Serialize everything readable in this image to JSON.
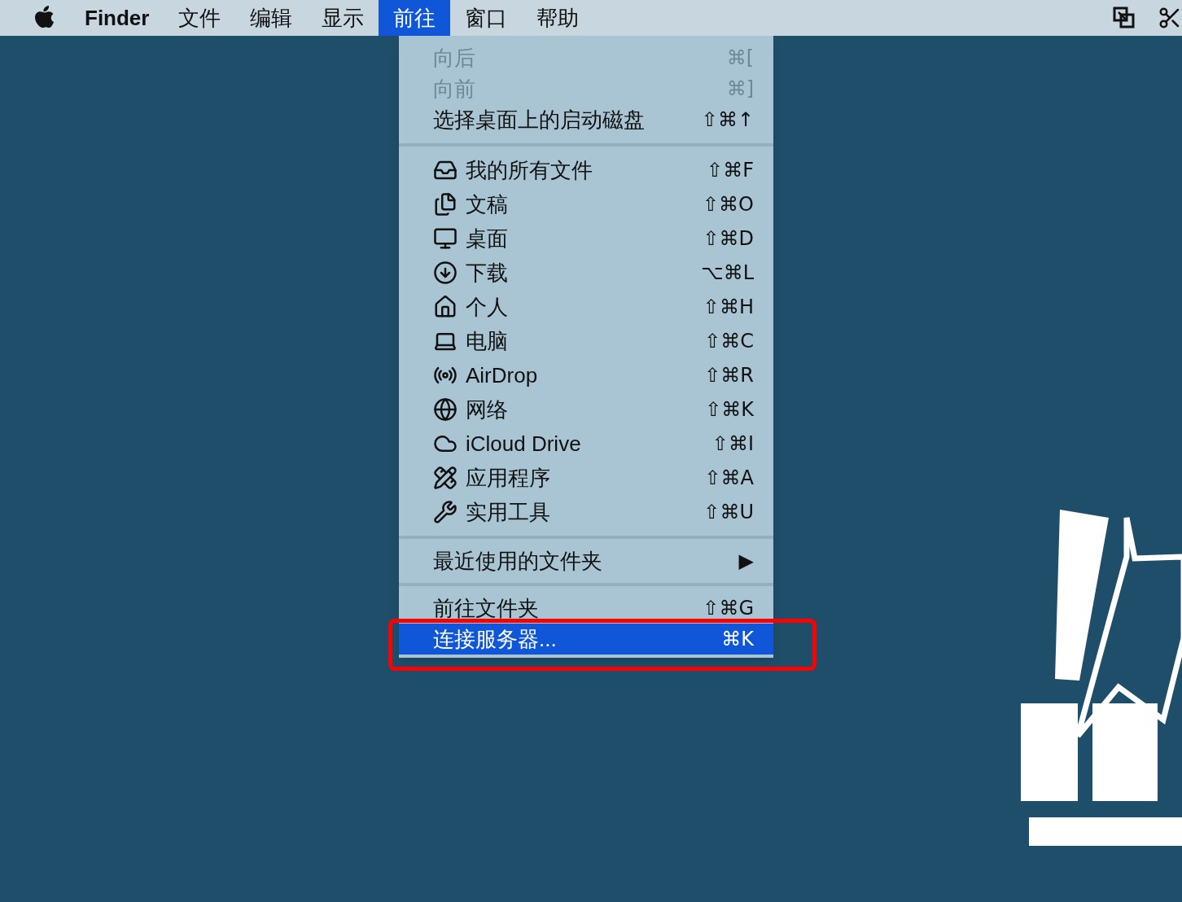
{
  "menu_bar": {
    "items": [
      {
        "label": "Finder",
        "kind": "app",
        "selected": false
      },
      {
        "label": "文件",
        "kind": "menu",
        "selected": false
      },
      {
        "label": "编辑",
        "kind": "menu",
        "selected": false
      },
      {
        "label": "显示",
        "kind": "menu",
        "selected": false
      },
      {
        "label": "前往",
        "kind": "menu",
        "selected": true
      },
      {
        "label": "窗口",
        "kind": "menu",
        "selected": false
      },
      {
        "label": "帮助",
        "kind": "menu",
        "selected": false
      }
    ]
  },
  "go_menu": {
    "sections": [
      [
        {
          "label": "向后",
          "shortcut": "⌘[",
          "disabled": true,
          "selected": false
        },
        {
          "label": "向前",
          "shortcut": "⌘]",
          "disabled": true,
          "selected": false
        },
        {
          "label": "选择桌面上的启动磁盘",
          "shortcut": "⇧⌘↑",
          "disabled": false,
          "selected": false
        }
      ],
      [
        {
          "label": "我的所有文件",
          "shortcut": "⇧⌘F",
          "disabled": false,
          "selected": false
        },
        {
          "label": "文稿",
          "shortcut": "⇧⌘O",
          "disabled": false,
          "selected": false
        },
        {
          "label": "桌面",
          "shortcut": "⇧⌘D",
          "disabled": false,
          "selected": false
        },
        {
          "label": "下载",
          "shortcut": "⌥⌘L",
          "disabled": false,
          "selected": false
        },
        {
          "label": "个人",
          "shortcut": "⇧⌘H",
          "disabled": false,
          "selected": false
        },
        {
          "label": "电脑",
          "shortcut": "⇧⌘C",
          "disabled": false,
          "selected": false
        },
        {
          "label": "AirDrop",
          "shortcut": "⇧⌘R",
          "disabled": false,
          "selected": false
        },
        {
          "label": "网络",
          "shortcut": "⇧⌘K",
          "disabled": false,
          "selected": false
        },
        {
          "label": "iCloud Drive",
          "shortcut": "⇧⌘I",
          "disabled": false,
          "selected": false
        },
        {
          "label": "应用程序",
          "shortcut": "⇧⌘A",
          "disabled": false,
          "selected": false
        },
        {
          "label": "实用工具",
          "shortcut": "⇧⌘U",
          "disabled": false,
          "selected": false
        }
      ],
      [
        {
          "label": "最近使用的文件夹",
          "shortcut": "▶",
          "disabled": false,
          "selected": false
        }
      ],
      [
        {
          "label": "前往文件夹",
          "shortcut": "⇧⌘G",
          "disabled": false,
          "selected": false
        },
        {
          "label": "连接服务器...",
          "shortcut": "⌘K",
          "disabled": false,
          "selected": true,
          "highlighted_by_annotation": true
        }
      ]
    ]
  }
}
